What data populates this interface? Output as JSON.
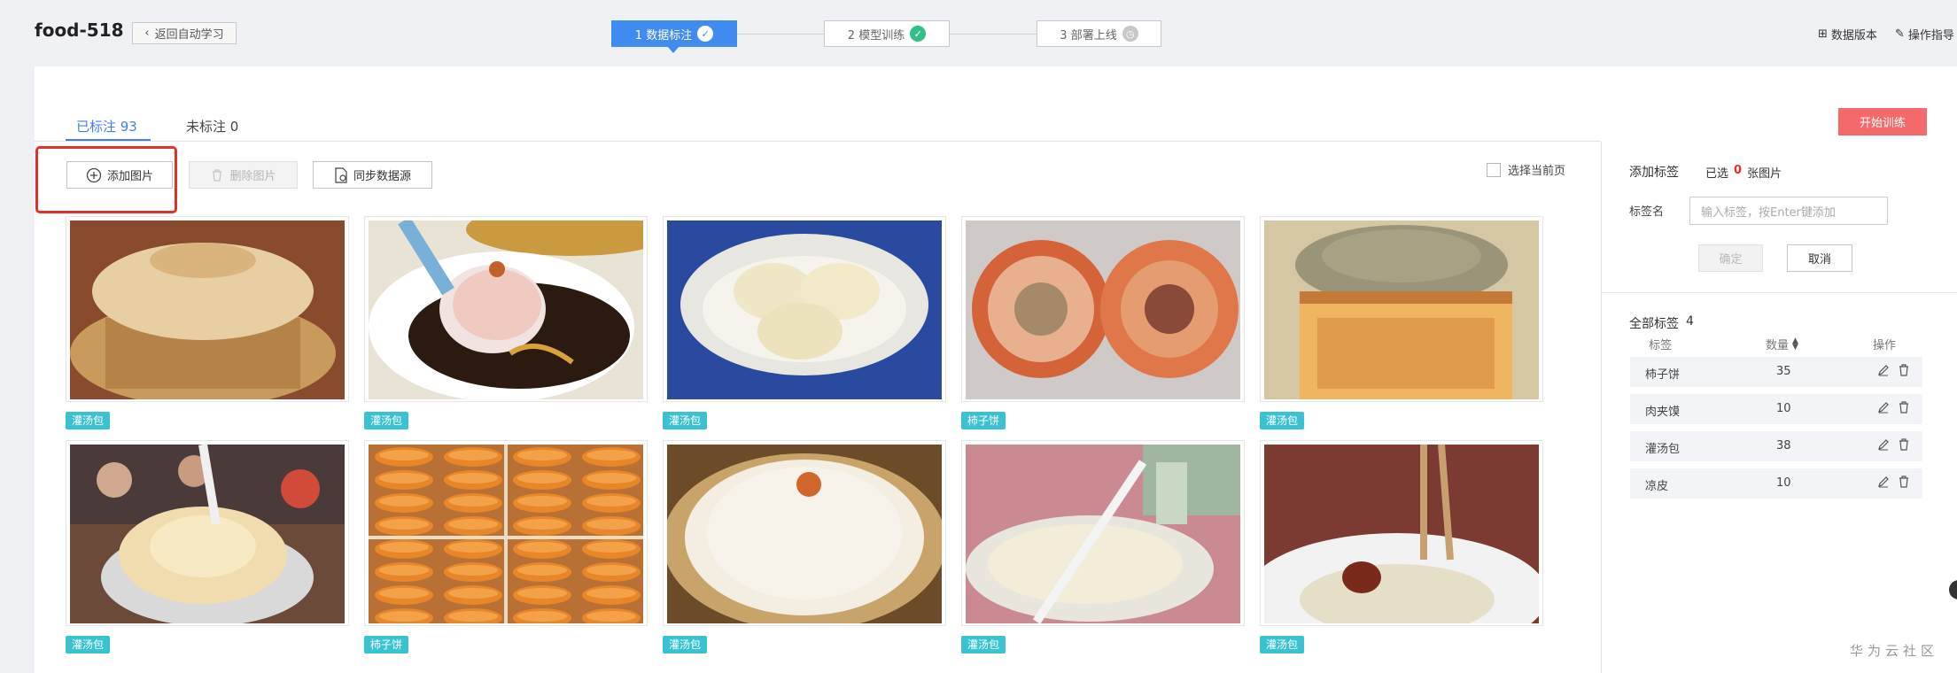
{
  "header": {
    "title": "food-518",
    "back_label": "返回自动学习",
    "steps": [
      {
        "label": "1 数据标注",
        "status": "current"
      },
      {
        "label": "2 模型训练",
        "status": "done"
      },
      {
        "label": "3 部署上线",
        "status": "pending"
      }
    ],
    "links": {
      "data_version": "数据版本",
      "help": "操作指导"
    }
  },
  "tabs": {
    "labeled": "已标注 93",
    "unlabeled": "未标注 0"
  },
  "toolbar": {
    "add": "添加图片",
    "delete": "删除图片",
    "sync": "同步数据源",
    "select_page": "选择当前页",
    "start_train": "开始训练"
  },
  "images": [
    {
      "tag": "灌汤包",
      "kind": "bun"
    },
    {
      "tag": "灌汤包",
      "kind": "spoon"
    },
    {
      "tag": "灌汤包",
      "kind": "bowl"
    },
    {
      "tag": "柿子饼",
      "kind": "persimmon"
    },
    {
      "tag": "灌汤包",
      "kind": "boxbun"
    },
    {
      "tag": "灌汤包",
      "kind": "cup"
    },
    {
      "tag": "柿子饼",
      "kind": "rows"
    },
    {
      "tag": "灌汤包",
      "kind": "steamer"
    },
    {
      "tag": "灌汤包",
      "kind": "plate"
    },
    {
      "tag": "灌汤包",
      "kind": "chopsticks"
    }
  ],
  "labels_panel": {
    "add_title": "添加标签",
    "selected_prefix": "已选",
    "selected_count": "0",
    "selected_suffix": "张图片",
    "name_label": "标签名",
    "input_placeholder": "输入标签，按Enter键添加",
    "ok": "确定",
    "cancel": "取消",
    "all_title": "全部标签",
    "all_count": "4",
    "col_label": "标签",
    "col_count": "数量",
    "col_ops": "操作",
    "rows": [
      {
        "name": "柿子饼",
        "count": "35"
      },
      {
        "name": "肉夹馍",
        "count": "10"
      },
      {
        "name": "灌汤包",
        "count": "38"
      },
      {
        "name": "凉皮",
        "count": "10"
      }
    ]
  },
  "watermark": "华为云社区",
  "colors": {
    "primary": "#3f8bef",
    "danger": "#f46a6a",
    "tag": "#3ac2d3",
    "success": "#32c08a",
    "highlight": "#e3302b"
  }
}
